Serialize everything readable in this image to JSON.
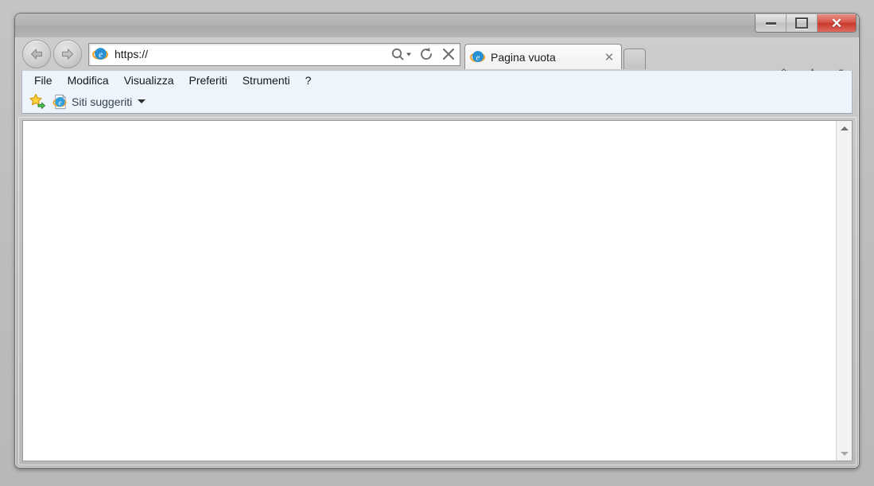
{
  "window": {
    "controls": {
      "minimize_label": "Riduci a icona",
      "maximize_label": "Ingrandisci",
      "close_label": "Chiudi",
      "close_glyph": "✕"
    },
    "close_button_color": "#c9392e"
  },
  "navigation": {
    "back_label": "Indietro",
    "forward_label": "Avanti"
  },
  "address": {
    "value": "https://",
    "placeholder": "https://",
    "favicon_name": "internet-explorer-icon",
    "search_label": "Cerca",
    "refresh_label": "Aggiorna",
    "stop_label": "Interrompi"
  },
  "tabs": [
    {
      "label": "Pagina vuota",
      "favicon_name": "internet-explorer-icon",
      "close_glyph": "✕",
      "active": true
    }
  ],
  "new_tab": {
    "label": "Nuova scheda"
  },
  "command_icons": [
    {
      "name": "home-icon",
      "label": "Pagina iniziale"
    },
    {
      "name": "favorites-star-icon",
      "label": "Preferiti"
    },
    {
      "name": "gear-icon",
      "label": "Strumenti"
    }
  ],
  "menubar": {
    "items": [
      {
        "label": "File"
      },
      {
        "label": "Modifica"
      },
      {
        "label": "Visualizza"
      },
      {
        "label": "Preferiti"
      },
      {
        "label": "Strumenti"
      },
      {
        "label": "?"
      }
    ]
  },
  "favorites_bar": {
    "add_button_label": "Aggiungi a Preferiti",
    "suggested_sites": {
      "label": "Siti suggeriti",
      "has_dropdown": true
    }
  },
  "content": {
    "page_text": "",
    "background_color": "#ffffff"
  },
  "scrollbar": {
    "up_label": "Scorri verso l'alto",
    "down_label": "Scorri verso il basso"
  }
}
